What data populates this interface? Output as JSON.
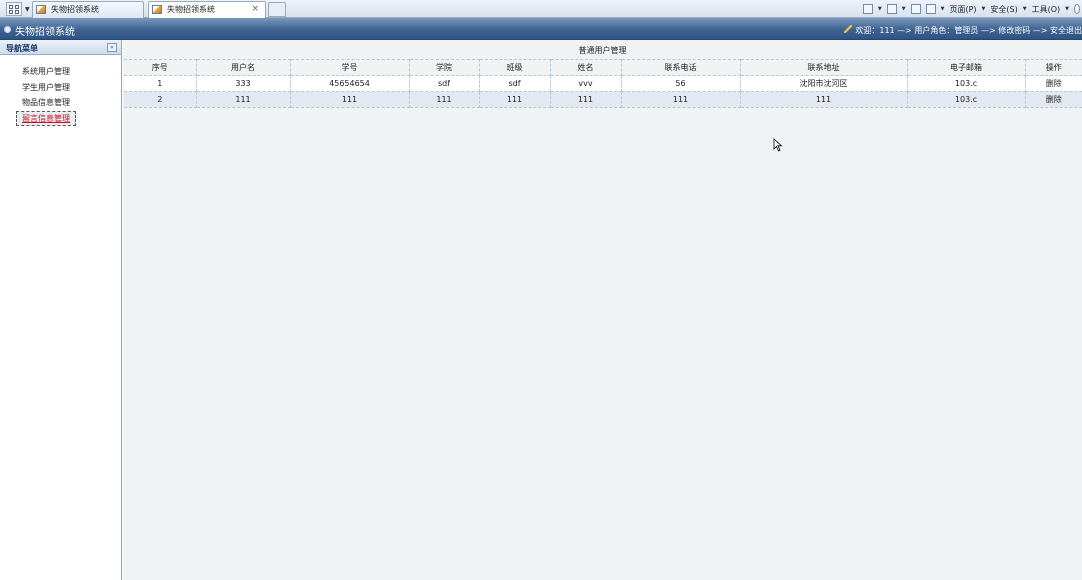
{
  "browser": {
    "tabs": [
      {
        "label": "失物招领系统",
        "active": false
      },
      {
        "label": "失物招领系统",
        "active": true
      }
    ],
    "close_glyph": "×",
    "commands": {
      "page": "页面(P)",
      "safety": "安全(S)",
      "tools": "工具(O)"
    }
  },
  "app": {
    "title": "失物招领系统",
    "userbar": "欢迎：111 —> 用户角色：管理员 —> 修改密码 —> 安全退出"
  },
  "sidebar": {
    "title": "导航菜单",
    "collapse_glyph": "«",
    "items": [
      {
        "label": "系统用户管理"
      },
      {
        "label": "学生用户管理"
      },
      {
        "label": "物品信息管理"
      },
      {
        "label": "留言信息管理"
      }
    ]
  },
  "grid": {
    "title": "普通用户管理",
    "headers": [
      "序号",
      "用户名",
      "学号",
      "学院",
      "班级",
      "姓名",
      "联系电话",
      "联系地址",
      "电子邮箱",
      "操作"
    ],
    "rows": [
      [
        "1",
        "333",
        "45654654",
        "sdf",
        "sdf",
        "vvv",
        "56",
        "沈阳市沈河区",
        "103.c",
        "删除"
      ],
      [
        "2",
        "111",
        "111",
        "111",
        "111",
        "111",
        "111",
        "111",
        "103.c",
        "删除"
      ]
    ]
  },
  "colors": {
    "header_blue": "#3e6391",
    "active_menu_red": "#d0101a",
    "grid_bg": "#eff3f4",
    "alt_row": "#e4e8f3"
  }
}
